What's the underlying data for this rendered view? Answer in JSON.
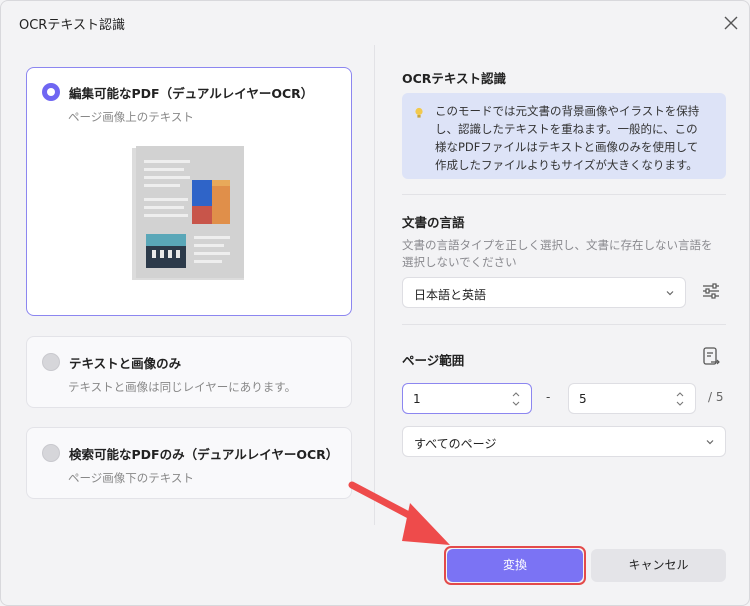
{
  "window": {
    "title": "OCRテキスト認識"
  },
  "options": [
    {
      "title": "編集可能なPDF（デュアルレイヤーOCR）",
      "subtitle": "ページ画像上のテキスト",
      "selected": true
    },
    {
      "title": "テキストと画像のみ",
      "subtitle": "テキストと画像は同じレイヤーにあります。",
      "selected": false
    },
    {
      "title": "検索可能なPDFのみ（デュアルレイヤーOCR）",
      "subtitle": "ページ画像下のテキスト",
      "selected": false
    }
  ],
  "ocr_section": {
    "heading": "OCRテキスト認識",
    "info_lines": [
      "このモードでは元文書の背景画像やイラストを保持",
      "し、認識したテキストを重ねます。一般的に、この",
      "様なPDFファイルはテキストと画像のみを使用して",
      "作成したファイルよりもサイズが大きくなります。"
    ]
  },
  "language_section": {
    "heading": "文書の言語",
    "desc_lines": [
      "文書の言語タイプを正しく選択し、文書に存在しない言語を",
      "選択しないでください"
    ],
    "selected": "日本語と英語"
  },
  "page_range": {
    "heading": "ページ範囲",
    "from": "1",
    "separator": "-",
    "to": "5",
    "total": "/ 5",
    "scope": "すべてのページ"
  },
  "buttons": {
    "convert": "変換",
    "cancel": "キャンセル"
  },
  "colors": {
    "accent": "#7b73f4",
    "highlight": "#e34a4a",
    "info_bg": "#dde3f7"
  }
}
